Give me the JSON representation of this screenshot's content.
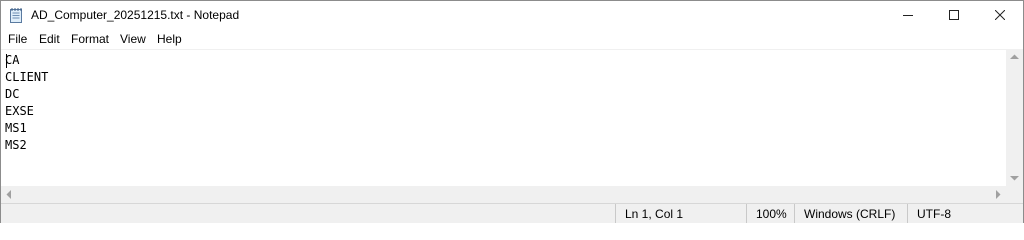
{
  "window": {
    "title": "AD_Computer_20251215.txt - Notepad",
    "app_icon": "notepad-icon"
  },
  "menu": {
    "file": "File",
    "edit": "Edit",
    "format": "Format",
    "view": "View",
    "help": "Help"
  },
  "editor": {
    "lines": [
      "CA",
      "CLIENT",
      "DC",
      "EXSE",
      "MS1",
      "MS2"
    ]
  },
  "status": {
    "position": "Ln 1, Col 1",
    "zoom": "100%",
    "line_ending": "Windows (CRLF)",
    "encoding": "UTF-8"
  }
}
